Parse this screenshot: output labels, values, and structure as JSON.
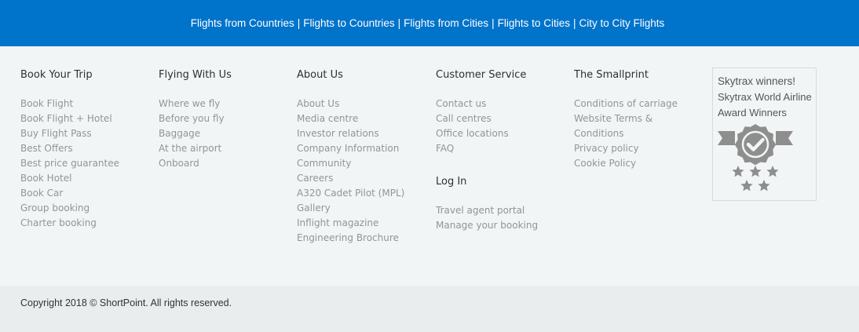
{
  "topbar": {
    "links": [
      "Flights from Countries",
      "Flights to Countries",
      "Flights from Cities",
      "Flights to Cities",
      "City to City Flights"
    ],
    "separator": "|"
  },
  "columns": [
    {
      "heading": "Book Your Trip",
      "items": [
        "Book Flight",
        "Book Flight + Hotel",
        "Buy Flight Pass",
        "Best Offers",
        "Best price guarantee",
        "Book Hotel",
        "Book Car",
        "Group booking",
        "Charter booking"
      ]
    },
    {
      "heading": "Flying With Us",
      "items": [
        "Where we fly",
        "Before you fly",
        "Baggage",
        "At the airport",
        "Onboard"
      ]
    },
    {
      "heading": "About Us",
      "items": [
        "About Us",
        "Media centre",
        "Investor relations",
        "Company Information",
        "Community",
        "Careers",
        "A320 Cadet Pilot (MPL)",
        "Gallery",
        "Inflight magazine",
        "Engineering Brochure"
      ]
    },
    {
      "heading": "Customer Service",
      "items": [
        "Contact us",
        "Call centres",
        "Office locations",
        "FAQ"
      ],
      "sub_heading": "Log In",
      "sub_items": [
        "Travel agent portal",
        "Manage your booking"
      ]
    },
    {
      "heading": "The Smallprint",
      "items": [
        "Conditions of carriage",
        "Website Terms &",
        "Conditions",
        "Privacy policy",
        "Cookie Policy"
      ]
    }
  ],
  "award": {
    "title": "Skytrax winners!",
    "line1": "Skytrax World Airline",
    "line2": "Award Winners",
    "icon": "award-badge-icon",
    "icon_color": "#8e8e8e"
  },
  "footer": {
    "copyright": "Copyright 2018 © ShortPoint. All rights reserved."
  },
  "colors": {
    "topbar": "#0073cb",
    "background": "#f2f5f6",
    "footer": "#e9edee",
    "link": "#949494",
    "heading": "#2f2f2f"
  }
}
